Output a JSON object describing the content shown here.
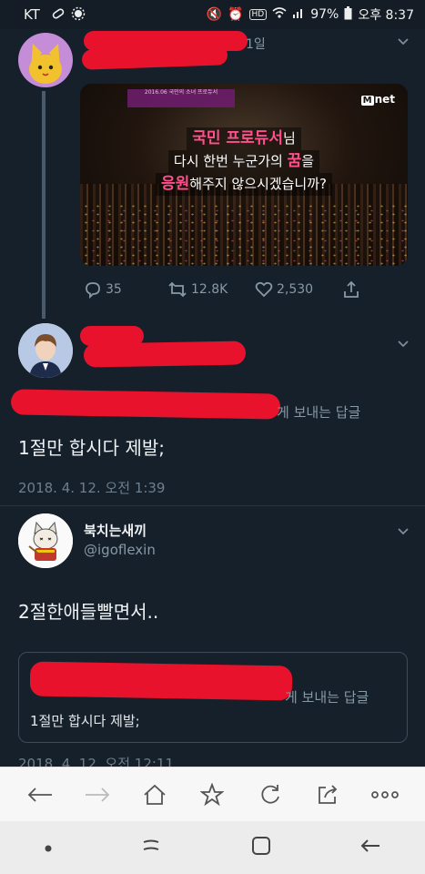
{
  "status_bar": {
    "carrier": "KT",
    "battery": "97%",
    "time": "오후 8:37",
    "network": "HD"
  },
  "tweet1": {
    "date_fragment": "1일",
    "video": {
      "header_small": "2016.06 국민의 소녀 프로듀서",
      "logo": "net",
      "line1_a": "국민 프로듀서",
      "line1_b": "님",
      "line2_a": "다시 한번 누군가의 ",
      "line2_b": "꿈",
      "line2_c": "을",
      "line3_a": "응원",
      "line3_b": "해주지 않으시겠습니까?"
    },
    "replies": "35",
    "retweets": "12.8K",
    "likes": "2,530"
  },
  "tweet2": {
    "reply_to": "게 보내는 답글",
    "text": "1절만 합시다 제발;",
    "timestamp": "2018. 4. 12. 오전 1:39"
  },
  "tweet3": {
    "display_name": "북치는새끼",
    "handle": "@igoflexin",
    "text": "2절한애들빨면서..",
    "quote": {
      "reply_to": "게 보내는 답글",
      "text": "1절만 합시다 제발;"
    },
    "next_timestamp_partial": "2018. 4. 12. 오전 12:11"
  },
  "colors": {
    "background": "#15202b",
    "redaction": "#e8122c",
    "accent_pink": "#ff4f8c"
  }
}
